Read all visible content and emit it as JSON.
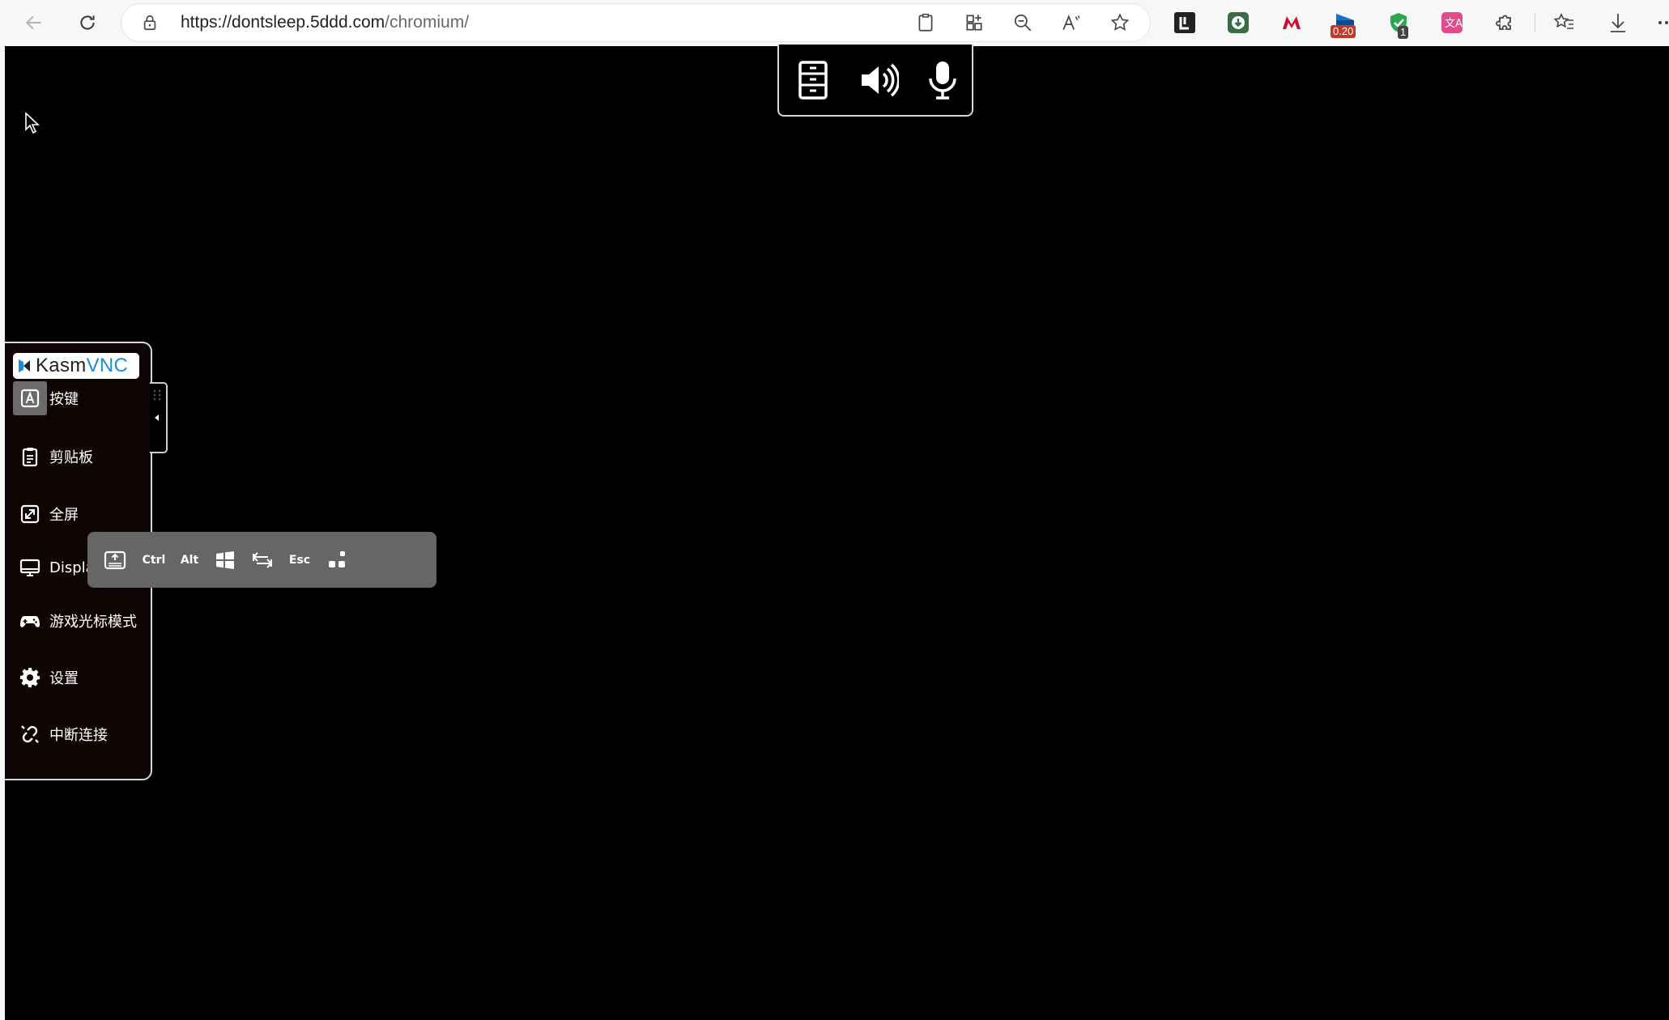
{
  "browser": {
    "url_host": "https://dontsleep.5ddd.com",
    "url_path": "/chromium/",
    "extensions": [
      {
        "icon": "reader-extension-icon"
      },
      {
        "icon": "download-extension-icon"
      },
      {
        "icon": "red-m-extension-icon"
      },
      {
        "icon": "speed-extension-icon",
        "badge": "0.20"
      },
      {
        "icon": "shield-extension-icon",
        "badge": "1"
      },
      {
        "icon": "translate-extension-icon"
      }
    ]
  },
  "kasm": {
    "logo_kasm": "Kasm",
    "logo_vnc": "VNC",
    "sidebar": [
      {
        "id": "keys",
        "label": "按键",
        "icon": "keyboard-a-icon",
        "active": true
      },
      {
        "id": "clipboard",
        "label": "剪贴板",
        "icon": "clipboard-icon"
      },
      {
        "id": "fullscreen",
        "label": "全屏",
        "icon": "fullscreen-icon"
      },
      {
        "id": "display",
        "label": "Displa",
        "icon": "display-icon"
      },
      {
        "id": "game-cursor",
        "label": "游戏光标模式",
        "icon": "gamepad-icon"
      },
      {
        "id": "settings",
        "label": "设置",
        "icon": "gear-icon"
      },
      {
        "id": "disconnect",
        "label": "中断连接",
        "icon": "disconnect-icon"
      }
    ],
    "keys_bar": {
      "ctrl": "Ctrl",
      "alt": "Alt",
      "esc": "Esc"
    },
    "topbar": [
      "server-icon",
      "speaker-icon",
      "microphone-icon"
    ]
  }
}
